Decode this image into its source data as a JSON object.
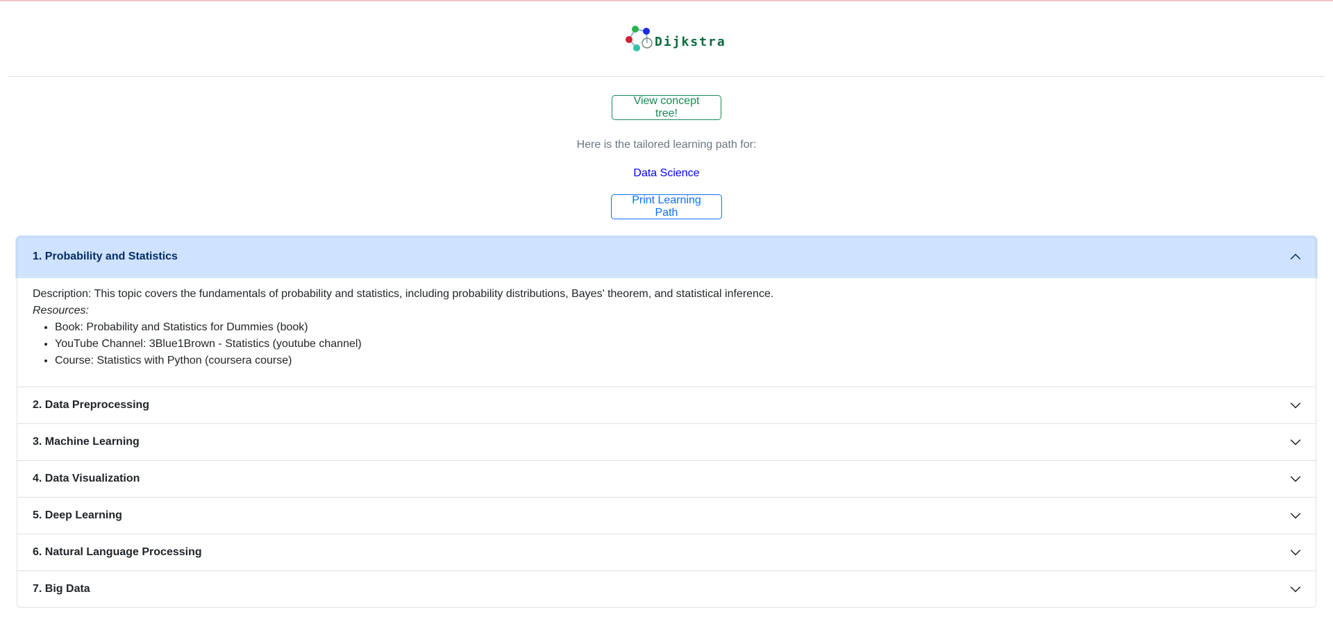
{
  "logo": {
    "text": "Dijkstra",
    "node_colors": [
      "#2bb24c",
      "#1e2be0",
      "#d4202f",
      "#2ec4a5"
    ]
  },
  "concept_button": {
    "label": "View concept tree!"
  },
  "intro_text": "Here is the tailored learning path for:",
  "topic": "Data Science",
  "print_button": {
    "label": "Print Learning Path"
  },
  "accordion": {
    "items": [
      {
        "title": "1. Probability and Statistics",
        "expanded": true,
        "description": "Description: This topic covers the fundamentals of probability and statistics, including probability distributions, Bayes' theorem, and statistical inference.",
        "resources_label": "Resources:",
        "resources": [
          "Book: Probability and Statistics for Dummies (book)",
          "YouTube Channel: 3Blue1Brown - Statistics (youtube channel)",
          "Course: Statistics with Python (coursera course)"
        ]
      },
      {
        "title": "2. Data Preprocessing",
        "expanded": false
      },
      {
        "title": "3. Machine Learning",
        "expanded": false
      },
      {
        "title": "4. Data Visualization",
        "expanded": false
      },
      {
        "title": "5. Deep Learning",
        "expanded": false
      },
      {
        "title": "6. Natural Language Processing",
        "expanded": false
      },
      {
        "title": "7. Big Data",
        "expanded": false
      }
    ]
  },
  "colors": {
    "accent_blue": "#0d6efd",
    "success_green": "#198754",
    "active_header_bg": "#cfe2ff",
    "topic_link": "#0000ff"
  }
}
